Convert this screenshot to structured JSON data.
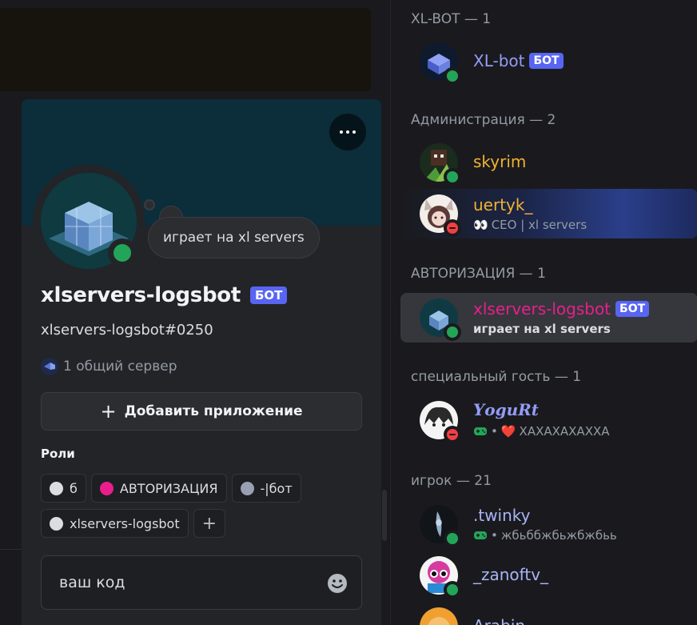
{
  "profile": {
    "activity_bubble": "играет на xl servers",
    "display_name": "xlservers-logsbot",
    "bot_badge": "БОТ",
    "username": "xlservers-logsbot#0250",
    "mutual_servers": "1 общий сервер",
    "add_app_label": "Добавить приложение",
    "roles_title": "Роли",
    "roles": [
      {
        "name": "б",
        "color": "#dbdee1"
      },
      {
        "name": "АВТОРИЗАЦИЯ",
        "color": "#e91e8c"
      },
      {
        "name": "-|бот",
        "color": "#9aa0b4"
      },
      {
        "name": "xlservers-logsbot",
        "color": "#dbdee1"
      }
    ],
    "add_role_label": "+",
    "code_input_value": "ваш код"
  },
  "member_list": {
    "groups": [
      {
        "title": "XL-BOT — 1"
      },
      {
        "title": "Администрация — 2"
      },
      {
        "title": "АВТОРИЗАЦИЯ — 1"
      },
      {
        "title": "специальный гость — 1"
      },
      {
        "title": "игрок — 21"
      }
    ],
    "members": [
      {
        "name": "XL-bot",
        "badge": "БОТ",
        "color": "#949cf7",
        "status": "online"
      },
      {
        "name": "skyrim",
        "color": "#f0b232",
        "status": "online"
      },
      {
        "name": "uertyk_",
        "color": "#f0b232",
        "status": "dnd",
        "sub": "CEO | xl servers"
      },
      {
        "name": "xlservers-logsbot",
        "badge": "БОТ",
        "color": "#e91e8c",
        "status": "online",
        "sub": "играет на xl servers"
      },
      {
        "name": "𝒀𝒐𝒈𝒖𝑹𝒕",
        "color": "#949cf7",
        "status": "dnd",
        "sub": "ХАХАХАХАХХА"
      },
      {
        "name": ".twinky",
        "color": "#a9b5f5",
        "status": "online",
        "sub": "жбьббжбьжбжбьь"
      },
      {
        "name": "_zanoftv_",
        "color": "#a9b5f5",
        "status": "online"
      },
      {
        "name": "Arabin",
        "color": "#a9b5f5",
        "status": "online"
      }
    ],
    "sub_separator": "•",
    "eyes_emoji": "👀",
    "heart_emoji": "❤️"
  }
}
